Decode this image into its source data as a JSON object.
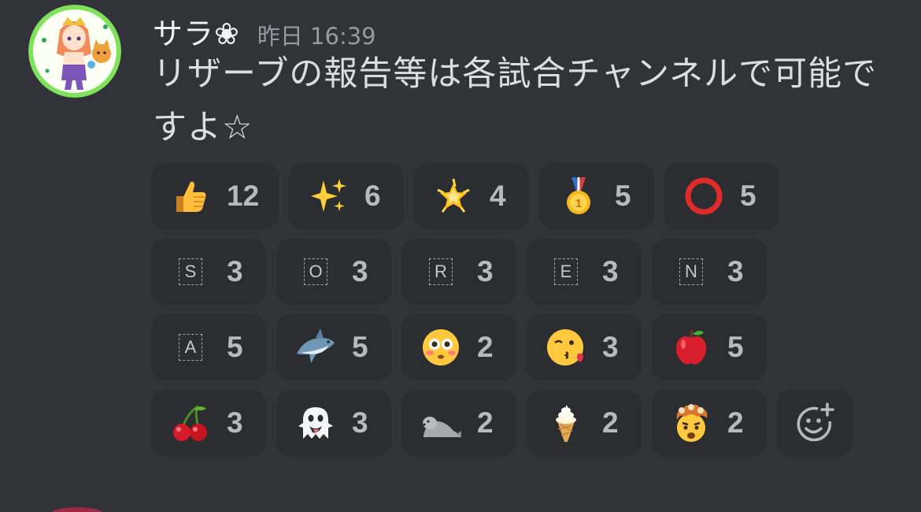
{
  "message": {
    "username": "サラ❀",
    "timestamp": "昨日 16:39",
    "text": "リザーブの報告等は各試合チャンネルで可能ですよ☆"
  },
  "reactions": [
    {
      "emoji": "thumbs-up",
      "count": "12"
    },
    {
      "emoji": "sparkles",
      "count": "6"
    },
    {
      "emoji": "glowing-star",
      "count": "4"
    },
    {
      "emoji": "first-place-medal",
      "count": "5"
    },
    {
      "emoji": "red-circle",
      "count": "5"
    },
    {
      "emoji": "letter-s",
      "letter": "S",
      "count": "3"
    },
    {
      "emoji": "letter-o",
      "letter": "O",
      "count": "3"
    },
    {
      "emoji": "letter-r",
      "letter": "R",
      "count": "3"
    },
    {
      "emoji": "letter-e",
      "letter": "E",
      "count": "3"
    },
    {
      "emoji": "letter-n",
      "letter": "N",
      "count": "3"
    },
    {
      "emoji": "letter-a",
      "letter": "A",
      "count": "5"
    },
    {
      "emoji": "shark",
      "count": "5"
    },
    {
      "emoji": "flushed-face",
      "count": "2"
    },
    {
      "emoji": "kissing-face",
      "count": "3"
    },
    {
      "emoji": "red-apple",
      "count": "5"
    },
    {
      "emoji": "cherries",
      "count": "3"
    },
    {
      "emoji": "ghost",
      "count": "3"
    },
    {
      "emoji": "seal",
      "count": "2"
    },
    {
      "emoji": "soft-ice-cream",
      "count": "2"
    },
    {
      "emoji": "exploding-head",
      "count": "2"
    }
  ],
  "add_reaction": {
    "icon": "add-reaction-icon"
  },
  "colors": {
    "background": "#313338",
    "reaction_bg": "#2b2d31",
    "username": "#f2f3f5",
    "timestamp": "#949ba4",
    "text": "#dbdee1",
    "count": "#b5bac1"
  }
}
